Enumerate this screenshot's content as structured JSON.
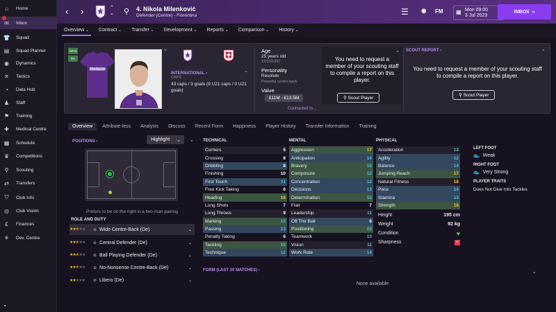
{
  "sidebar": {
    "items": [
      {
        "label": "Home",
        "icon": "home-icon"
      },
      {
        "label": "Inbox",
        "icon": "inbox-icon",
        "badge": true
      },
      {
        "label": "Squad",
        "icon": "shirt-icon"
      },
      {
        "label": "Squad Planner",
        "icon": "planner-icon"
      },
      {
        "label": "Dynamics",
        "icon": "dynamics-icon"
      },
      {
        "label": "Tactics",
        "icon": "tactics-icon"
      },
      {
        "label": "Data Hub",
        "icon": "data-hub-icon"
      },
      {
        "label": "Staff",
        "icon": "staff-icon"
      },
      {
        "label": "Training",
        "icon": "training-icon"
      },
      {
        "label": "Medical Centre",
        "icon": "medical-icon"
      },
      {
        "label": "Schedule",
        "icon": "calendar-icon"
      },
      {
        "label": "Competitions",
        "icon": "trophy-icon"
      },
      {
        "label": "Scouting",
        "icon": "binoculars-icon"
      },
      {
        "label": "Transfers",
        "icon": "transfer-icon"
      },
      {
        "label": "Club Info",
        "icon": "shield-icon"
      },
      {
        "label": "Club Vision",
        "icon": "vision-icon"
      },
      {
        "label": "Finances",
        "icon": "finances-icon"
      },
      {
        "label": "Dev. Centre",
        "icon": "dev-centre-icon"
      }
    ]
  },
  "header": {
    "player_name": "4. Nikola Milenković",
    "player_sub": "Defender (Centre) - Fiorentina",
    "date_day": "Mon 09:00",
    "date": "3 Jul 2023",
    "inbox_label": "INBOX",
    "fm_label": "FM"
  },
  "top_tabs": [
    "Overview",
    "Contract",
    "Transfer",
    "Development",
    "Reports",
    "Comparison",
    "History"
  ],
  "profile": {
    "int_label": "INTERNATIONAL",
    "caps_label": "CAPS",
    "caps_text": "43 caps / 3 goals (9 U21 caps / 0 U21 goals)",
    "tags": [
      "WCB",
      "DC"
    ],
    "age_label": "Age",
    "age": "25 years old",
    "dob": "12/10/1997",
    "personality_label": "Personality",
    "personality": "Resolute",
    "media": "Powerful centre-back",
    "value_label": "Value",
    "value": "£11M - £13.5M",
    "contract": "Contracted to...",
    "scout_msg": "You need to request a member of your scouting staff to compile a report on this player.",
    "scout_button": "Scout Player",
    "scout_report_label": "SCOUT REPORT"
  },
  "sub_tabs": [
    "Overview",
    "Attribute-less",
    "Analysis",
    "Discuss",
    "Recent Form",
    "Happiness",
    "Player History",
    "Transfer Information",
    "Training"
  ],
  "positions": {
    "label": "POSITIONS",
    "highlight": "Highlight",
    "note": "Prefers to be on the right in a two-man pairing",
    "role_duty_label": "ROLE AND DUTY"
  },
  "roles": [
    {
      "name": "Wide Centre-Back (De)",
      "stars": 2.5
    },
    {
      "name": "Central Defender (De)",
      "stars": 2.5
    },
    {
      "name": "Ball Playing Defender (De)",
      "stars": 2.5
    },
    {
      "name": "No-Nonsense Centre-Back (De)",
      "stars": 2.5
    },
    {
      "name": "Libero (De)",
      "stars": 2
    }
  ],
  "technical_label": "TECHNICAL",
  "technical": [
    {
      "name": "Corners",
      "value": "5"
    },
    {
      "name": "Crossing",
      "value": "8"
    },
    {
      "name": "Dribbling",
      "value": "8"
    },
    {
      "name": "Finishing",
      "value": "10"
    },
    {
      "name": "First Touch",
      "value": "11"
    },
    {
      "name": "Free Kick Taking",
      "value": "6"
    },
    {
      "name": "Heading",
      "value": "16"
    },
    {
      "name": "Long Shots",
      "value": "7"
    },
    {
      "name": "Long Throws",
      "value": "9"
    },
    {
      "name": "Marking",
      "value": "15"
    },
    {
      "name": "Passing",
      "value": "13"
    },
    {
      "name": "Penalty Taking",
      "value": "6"
    },
    {
      "name": "Tackling",
      "value": "15"
    },
    {
      "name": "Technique",
      "value": "12"
    }
  ],
  "mental_label": "MENTAL",
  "mental": [
    {
      "name": "Aggression",
      "value": "17"
    },
    {
      "name": "Anticipation",
      "value": "14"
    },
    {
      "name": "Bravery",
      "value": "15"
    },
    {
      "name": "Composure",
      "value": "12"
    },
    {
      "name": "Concentration",
      "value": "12"
    },
    {
      "name": "Decisions",
      "value": "13"
    },
    {
      "name": "Determination",
      "value": "15"
    },
    {
      "name": "Flair",
      "value": "7"
    },
    {
      "name": "Leadership",
      "value": "11"
    },
    {
      "name": "Off The Ball",
      "value": "6"
    },
    {
      "name": "Positioning",
      "value": "15"
    },
    {
      "name": "Teamwork",
      "value": "13"
    },
    {
      "name": "Vision",
      "value": "11"
    },
    {
      "name": "Work Rate",
      "value": "14"
    }
  ],
  "physical_label": "PHYSICAL",
  "physical": [
    {
      "name": "Acceleration",
      "value": "13"
    },
    {
      "name": "Agility",
      "value": "12"
    },
    {
      "name": "Balance",
      "value": "14"
    },
    {
      "name": "Jumping Reach",
      "value": "17"
    },
    {
      "name": "Natural Fitness",
      "value": "16"
    },
    {
      "name": "Pace",
      "value": "14"
    },
    {
      "name": "Stamina",
      "value": "13"
    },
    {
      "name": "Strength",
      "value": "16"
    }
  ],
  "physical_extra": {
    "height_label": "Height",
    "height": "195 cm",
    "weight_label": "Weight",
    "weight": "92 kg",
    "condition_label": "Condition",
    "sharpness_label": "Sharpness"
  },
  "foot": {
    "left_label": "LEFT FOOT",
    "left": "Weak",
    "right_label": "RIGHT FOOT",
    "right": "Very Strong",
    "traits_label": "PLAYER TRAITS",
    "trait": "Does Not Dive Into Tackles"
  },
  "form": {
    "label": "FORM (LAST 20 MATCHES)",
    "empty": "None available"
  },
  "colors": {
    "accent": "#8a3cf0",
    "green_hl": "#3c5542",
    "blue_hl": "#33485e",
    "gold": "#f0c838",
    "cyan": "#4fc3d9"
  }
}
